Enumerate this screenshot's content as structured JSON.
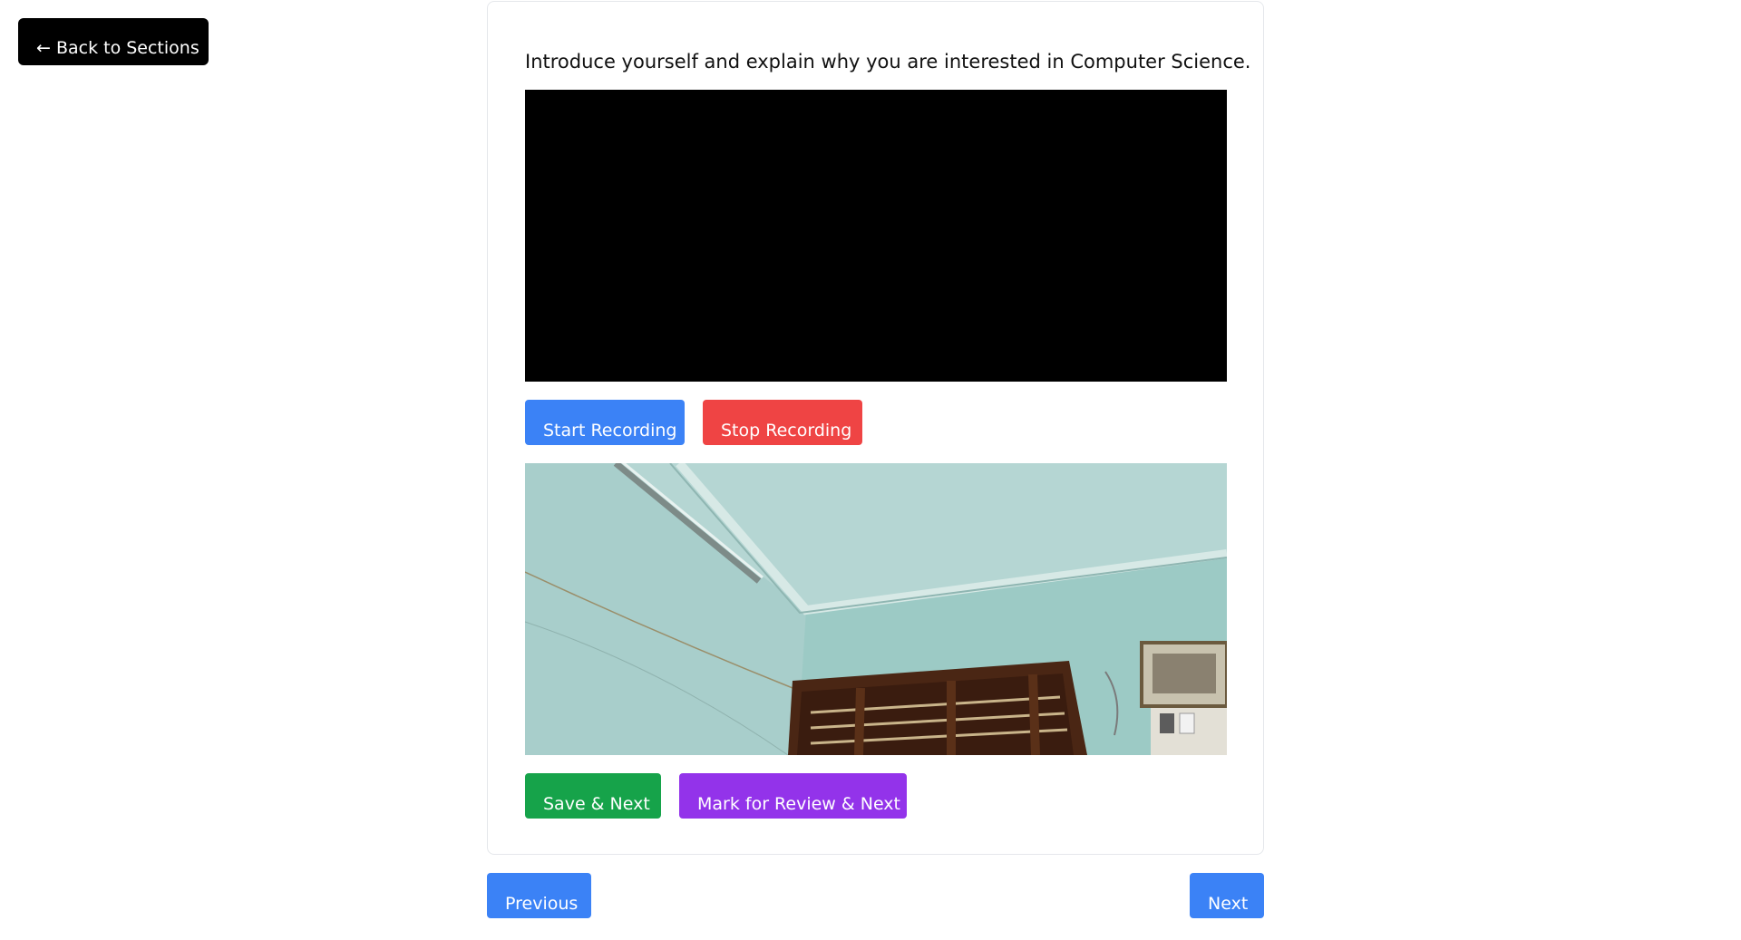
{
  "header": {
    "back_label": "← Back to Sections"
  },
  "question": {
    "text": "Introduce yourself and explain why you are interested in Computer Science."
  },
  "recording": {
    "start_label": "Start Recording",
    "stop_label": "Stop Recording"
  },
  "actions": {
    "save_next_label": "Save & Next",
    "review_next_label": "Mark for Review & Next"
  },
  "navigation": {
    "previous_label": "Previous",
    "next_label": "Next"
  },
  "colors": {
    "back_button": "#000000",
    "start_button": "#3b82f6",
    "stop_button": "#ef4444",
    "save_button": "#16a34a",
    "review_button": "#9333ea",
    "nav_button": "#3b82f6"
  }
}
